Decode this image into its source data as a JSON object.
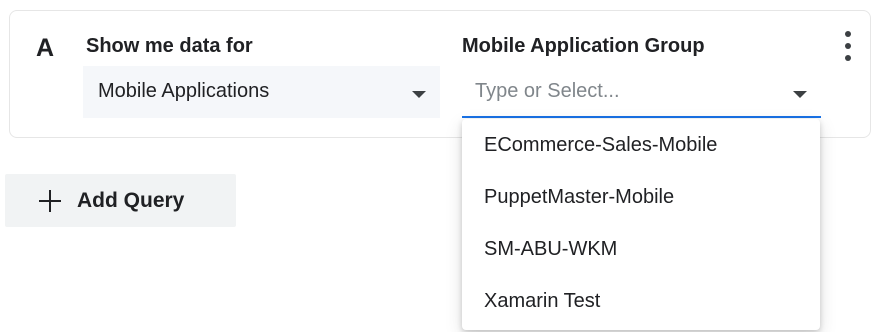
{
  "query": {
    "letter": "A",
    "show_me_label": "Show me data for",
    "data_source": {
      "selected": "Mobile Applications"
    },
    "group_label": "Mobile Application Group",
    "group_select": {
      "value": "",
      "placeholder": "Type or Select..."
    },
    "options": [
      {
        "label": "ECommerce-Sales-Mobile"
      },
      {
        "label": "PuppetMaster-Mobile"
      },
      {
        "label": "SM-ABU-WKM"
      },
      {
        "label": "Xamarin Test"
      }
    ]
  },
  "actions": {
    "add_query_label": "Add Query"
  },
  "colors": {
    "accent": "#1a73e8",
    "field_background": "#f5f7fa",
    "button_background": "#f1f3f4"
  },
  "icons": {
    "more": "more-vert-icon",
    "caret": "caret-down-icon",
    "plus": "plus-icon"
  }
}
